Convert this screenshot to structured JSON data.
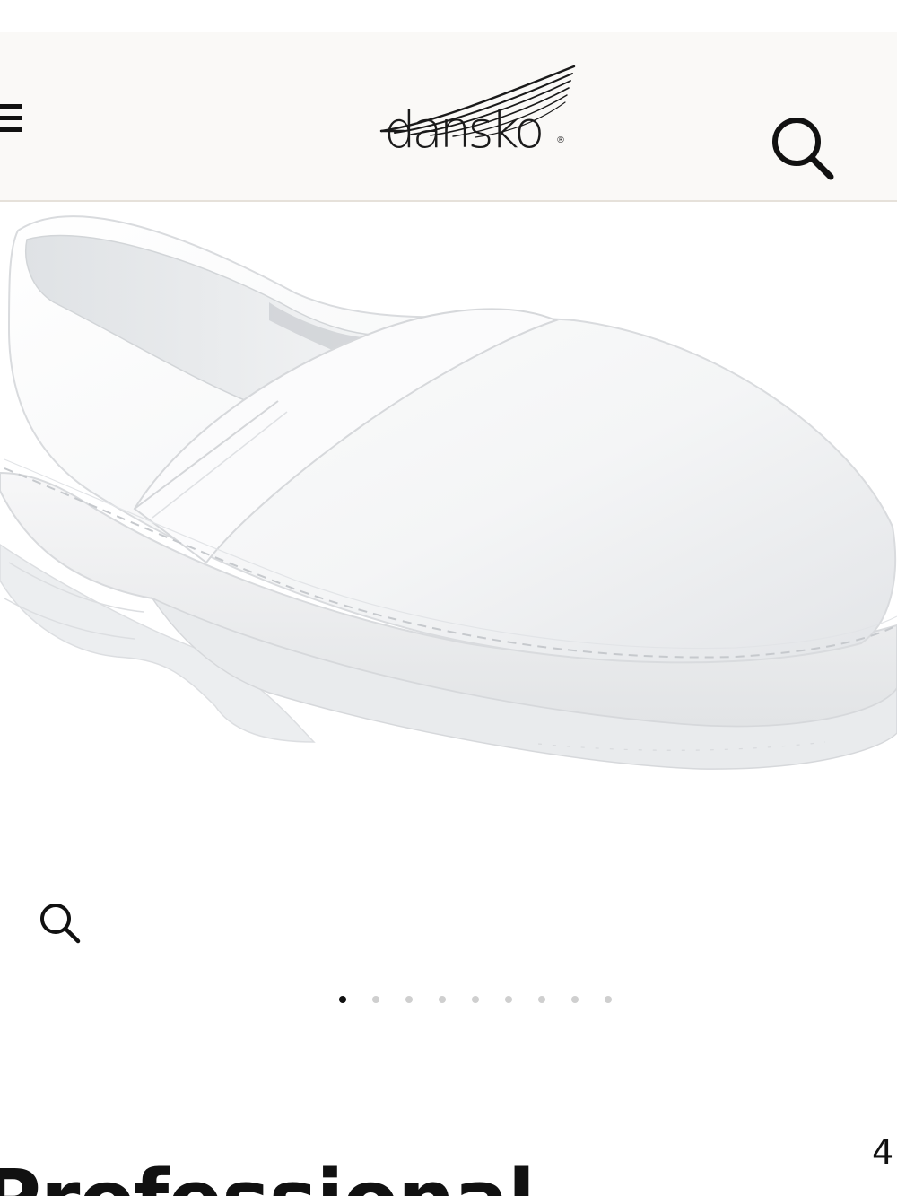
{
  "header": {
    "brand": "dansko",
    "menu_icon": "hamburger-menu-icon",
    "search_icon": "search-icon",
    "background": "#faf9f7"
  },
  "product": {
    "image_alt": "White leather clog",
    "zoom_icon": "zoom-icon",
    "carousel": {
      "count": 9,
      "active_index": 0
    },
    "title": "Professional",
    "price_partial": "4"
  }
}
